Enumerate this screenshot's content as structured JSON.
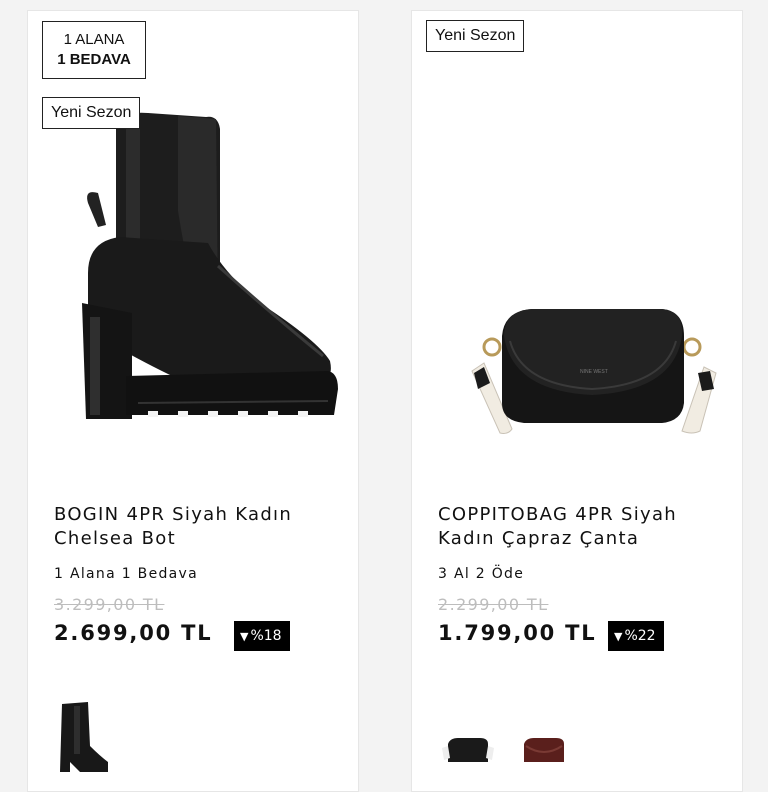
{
  "products": [
    {
      "promo_badge_line1": "1 ALANA",
      "promo_badge_line2": "1 BEDAVA",
      "season_badge": "Yeni Sezon",
      "title_line1": "BOGIN 4PR Siyah Kadın",
      "title_line2": "Chelsea Bot",
      "promotion": "1 Alana 1 Bedava",
      "old_price": "3.299,00 TL",
      "price": "2.699,00 TL",
      "discount": "%18",
      "discount_icon": "caret-down-icon",
      "image": "black-platform-heel-chelsea-boot",
      "color_thumbnails": [
        "black"
      ]
    },
    {
      "season_badge": "Yeni Sezon",
      "title_line1": "COPPITOBAG 4PR Siyah",
      "title_line2": "Kadın Çapraz Çanta",
      "promotion": "3 Al 2 Öde",
      "old_price": "2.299,00 TL",
      "price": "1.799,00 TL",
      "discount": "%22",
      "discount_icon": "caret-down-icon",
      "image": "black-crossbody-bag",
      "color_thumbnails": [
        "black",
        "burgundy"
      ]
    }
  ]
}
